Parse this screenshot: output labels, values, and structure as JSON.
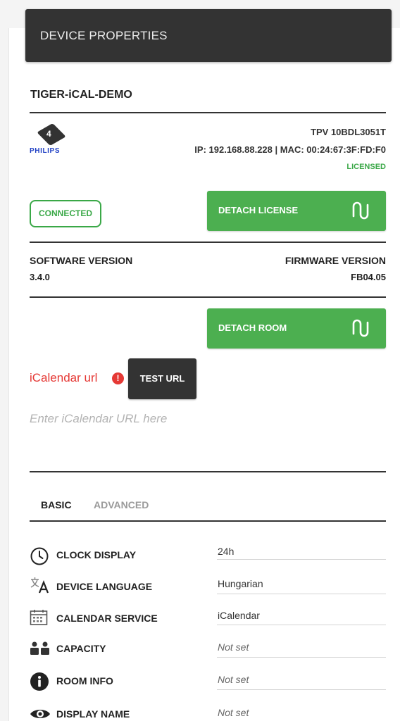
{
  "header": {
    "title": "DEVICE PROPERTIES"
  },
  "device": {
    "name": "TIGER-iCAL-DEMO",
    "logo_badge": "4",
    "brand": "PHILIPS",
    "model": "TPV 10BDL3051T",
    "network": "IP: 192.168.88.228 | MAC: 00:24:67:3F:FD:F0",
    "license_status": "LICENSED",
    "connection_status": "CONNECTED"
  },
  "actions": {
    "detach_license": "DETACH LICENSE",
    "detach_room": "DETACH ROOM",
    "test_url": "TEST URL"
  },
  "versions": {
    "software_label": "SOFTWARE VERSION",
    "software_value": "3.4.0",
    "firmware_label": "FIRMWARE VERSION",
    "firmware_value": "FB04.05"
  },
  "ical": {
    "label": "iCalendar url",
    "info_glyph": "!",
    "value": "",
    "placeholder": "Enter iCalendar URL here"
  },
  "tabs": [
    {
      "label": "BASIC",
      "active": true
    },
    {
      "label": "ADVANCED",
      "active": false
    }
  ],
  "properties": [
    {
      "icon": "clock-icon",
      "label": "CLOCK DISPLAY",
      "value": "24h"
    },
    {
      "icon": "translate-icon",
      "label": "DEVICE LANGUAGE",
      "value": "Hungarian"
    },
    {
      "icon": "calendar-icon",
      "label": "CALENDAR SERVICE",
      "value": "iCalendar"
    },
    {
      "icon": "people-icon",
      "label": "CAPACITY",
      "value": "Not set"
    },
    {
      "icon": "info-icon",
      "label": "ROOM INFO",
      "value": "Not set"
    },
    {
      "icon": "eye-icon",
      "label": "DISPLAY NAME",
      "value": "Not set"
    }
  ],
  "colors": {
    "header_bg": "#333333",
    "accent_green": "#4caf50",
    "status_green": "#3aa847",
    "error_red": "#e53935",
    "brand_blue": "#1f3fc4"
  }
}
